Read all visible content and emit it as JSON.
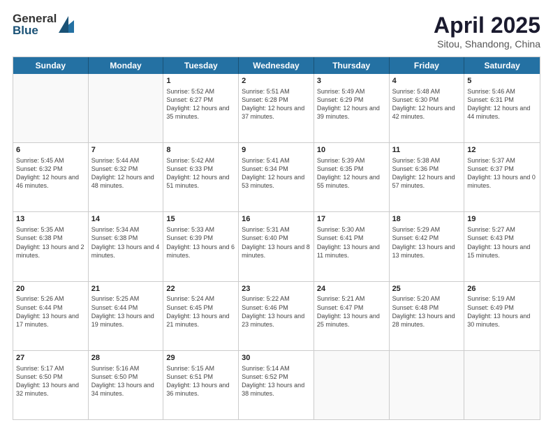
{
  "header": {
    "logo_general": "General",
    "logo_blue": "Blue",
    "month_title": "April 2025",
    "subtitle": "Sitou, Shandong, China"
  },
  "weekdays": [
    "Sunday",
    "Monday",
    "Tuesday",
    "Wednesday",
    "Thursday",
    "Friday",
    "Saturday"
  ],
  "weeks": [
    [
      {
        "day": "",
        "sunrise": "",
        "sunset": "",
        "daylight": ""
      },
      {
        "day": "",
        "sunrise": "",
        "sunset": "",
        "daylight": ""
      },
      {
        "day": "1",
        "sunrise": "Sunrise: 5:52 AM",
        "sunset": "Sunset: 6:27 PM",
        "daylight": "Daylight: 12 hours and 35 minutes."
      },
      {
        "day": "2",
        "sunrise": "Sunrise: 5:51 AM",
        "sunset": "Sunset: 6:28 PM",
        "daylight": "Daylight: 12 hours and 37 minutes."
      },
      {
        "day": "3",
        "sunrise": "Sunrise: 5:49 AM",
        "sunset": "Sunset: 6:29 PM",
        "daylight": "Daylight: 12 hours and 39 minutes."
      },
      {
        "day": "4",
        "sunrise": "Sunrise: 5:48 AM",
        "sunset": "Sunset: 6:30 PM",
        "daylight": "Daylight: 12 hours and 42 minutes."
      },
      {
        "day": "5",
        "sunrise": "Sunrise: 5:46 AM",
        "sunset": "Sunset: 6:31 PM",
        "daylight": "Daylight: 12 hours and 44 minutes."
      }
    ],
    [
      {
        "day": "6",
        "sunrise": "Sunrise: 5:45 AM",
        "sunset": "Sunset: 6:32 PM",
        "daylight": "Daylight: 12 hours and 46 minutes."
      },
      {
        "day": "7",
        "sunrise": "Sunrise: 5:44 AM",
        "sunset": "Sunset: 6:32 PM",
        "daylight": "Daylight: 12 hours and 48 minutes."
      },
      {
        "day": "8",
        "sunrise": "Sunrise: 5:42 AM",
        "sunset": "Sunset: 6:33 PM",
        "daylight": "Daylight: 12 hours and 51 minutes."
      },
      {
        "day": "9",
        "sunrise": "Sunrise: 5:41 AM",
        "sunset": "Sunset: 6:34 PM",
        "daylight": "Daylight: 12 hours and 53 minutes."
      },
      {
        "day": "10",
        "sunrise": "Sunrise: 5:39 AM",
        "sunset": "Sunset: 6:35 PM",
        "daylight": "Daylight: 12 hours and 55 minutes."
      },
      {
        "day": "11",
        "sunrise": "Sunrise: 5:38 AM",
        "sunset": "Sunset: 6:36 PM",
        "daylight": "Daylight: 12 hours and 57 minutes."
      },
      {
        "day": "12",
        "sunrise": "Sunrise: 5:37 AM",
        "sunset": "Sunset: 6:37 PM",
        "daylight": "Daylight: 13 hours and 0 minutes."
      }
    ],
    [
      {
        "day": "13",
        "sunrise": "Sunrise: 5:35 AM",
        "sunset": "Sunset: 6:38 PM",
        "daylight": "Daylight: 13 hours and 2 minutes."
      },
      {
        "day": "14",
        "sunrise": "Sunrise: 5:34 AM",
        "sunset": "Sunset: 6:38 PM",
        "daylight": "Daylight: 13 hours and 4 minutes."
      },
      {
        "day": "15",
        "sunrise": "Sunrise: 5:33 AM",
        "sunset": "Sunset: 6:39 PM",
        "daylight": "Daylight: 13 hours and 6 minutes."
      },
      {
        "day": "16",
        "sunrise": "Sunrise: 5:31 AM",
        "sunset": "Sunset: 6:40 PM",
        "daylight": "Daylight: 13 hours and 8 minutes."
      },
      {
        "day": "17",
        "sunrise": "Sunrise: 5:30 AM",
        "sunset": "Sunset: 6:41 PM",
        "daylight": "Daylight: 13 hours and 11 minutes."
      },
      {
        "day": "18",
        "sunrise": "Sunrise: 5:29 AM",
        "sunset": "Sunset: 6:42 PM",
        "daylight": "Daylight: 13 hours and 13 minutes."
      },
      {
        "day": "19",
        "sunrise": "Sunrise: 5:27 AM",
        "sunset": "Sunset: 6:43 PM",
        "daylight": "Daylight: 13 hours and 15 minutes."
      }
    ],
    [
      {
        "day": "20",
        "sunrise": "Sunrise: 5:26 AM",
        "sunset": "Sunset: 6:44 PM",
        "daylight": "Daylight: 13 hours and 17 minutes."
      },
      {
        "day": "21",
        "sunrise": "Sunrise: 5:25 AM",
        "sunset": "Sunset: 6:44 PM",
        "daylight": "Daylight: 13 hours and 19 minutes."
      },
      {
        "day": "22",
        "sunrise": "Sunrise: 5:24 AM",
        "sunset": "Sunset: 6:45 PM",
        "daylight": "Daylight: 13 hours and 21 minutes."
      },
      {
        "day": "23",
        "sunrise": "Sunrise: 5:22 AM",
        "sunset": "Sunset: 6:46 PM",
        "daylight": "Daylight: 13 hours and 23 minutes."
      },
      {
        "day": "24",
        "sunrise": "Sunrise: 5:21 AM",
        "sunset": "Sunset: 6:47 PM",
        "daylight": "Daylight: 13 hours and 25 minutes."
      },
      {
        "day": "25",
        "sunrise": "Sunrise: 5:20 AM",
        "sunset": "Sunset: 6:48 PM",
        "daylight": "Daylight: 13 hours and 28 minutes."
      },
      {
        "day": "26",
        "sunrise": "Sunrise: 5:19 AM",
        "sunset": "Sunset: 6:49 PM",
        "daylight": "Daylight: 13 hours and 30 minutes."
      }
    ],
    [
      {
        "day": "27",
        "sunrise": "Sunrise: 5:17 AM",
        "sunset": "Sunset: 6:50 PM",
        "daylight": "Daylight: 13 hours and 32 minutes."
      },
      {
        "day": "28",
        "sunrise": "Sunrise: 5:16 AM",
        "sunset": "Sunset: 6:50 PM",
        "daylight": "Daylight: 13 hours and 34 minutes."
      },
      {
        "day": "29",
        "sunrise": "Sunrise: 5:15 AM",
        "sunset": "Sunset: 6:51 PM",
        "daylight": "Daylight: 13 hours and 36 minutes."
      },
      {
        "day": "30",
        "sunrise": "Sunrise: 5:14 AM",
        "sunset": "Sunset: 6:52 PM",
        "daylight": "Daylight: 13 hours and 38 minutes."
      },
      {
        "day": "",
        "sunrise": "",
        "sunset": "",
        "daylight": ""
      },
      {
        "day": "",
        "sunrise": "",
        "sunset": "",
        "daylight": ""
      },
      {
        "day": "",
        "sunrise": "",
        "sunset": "",
        "daylight": ""
      }
    ]
  ]
}
